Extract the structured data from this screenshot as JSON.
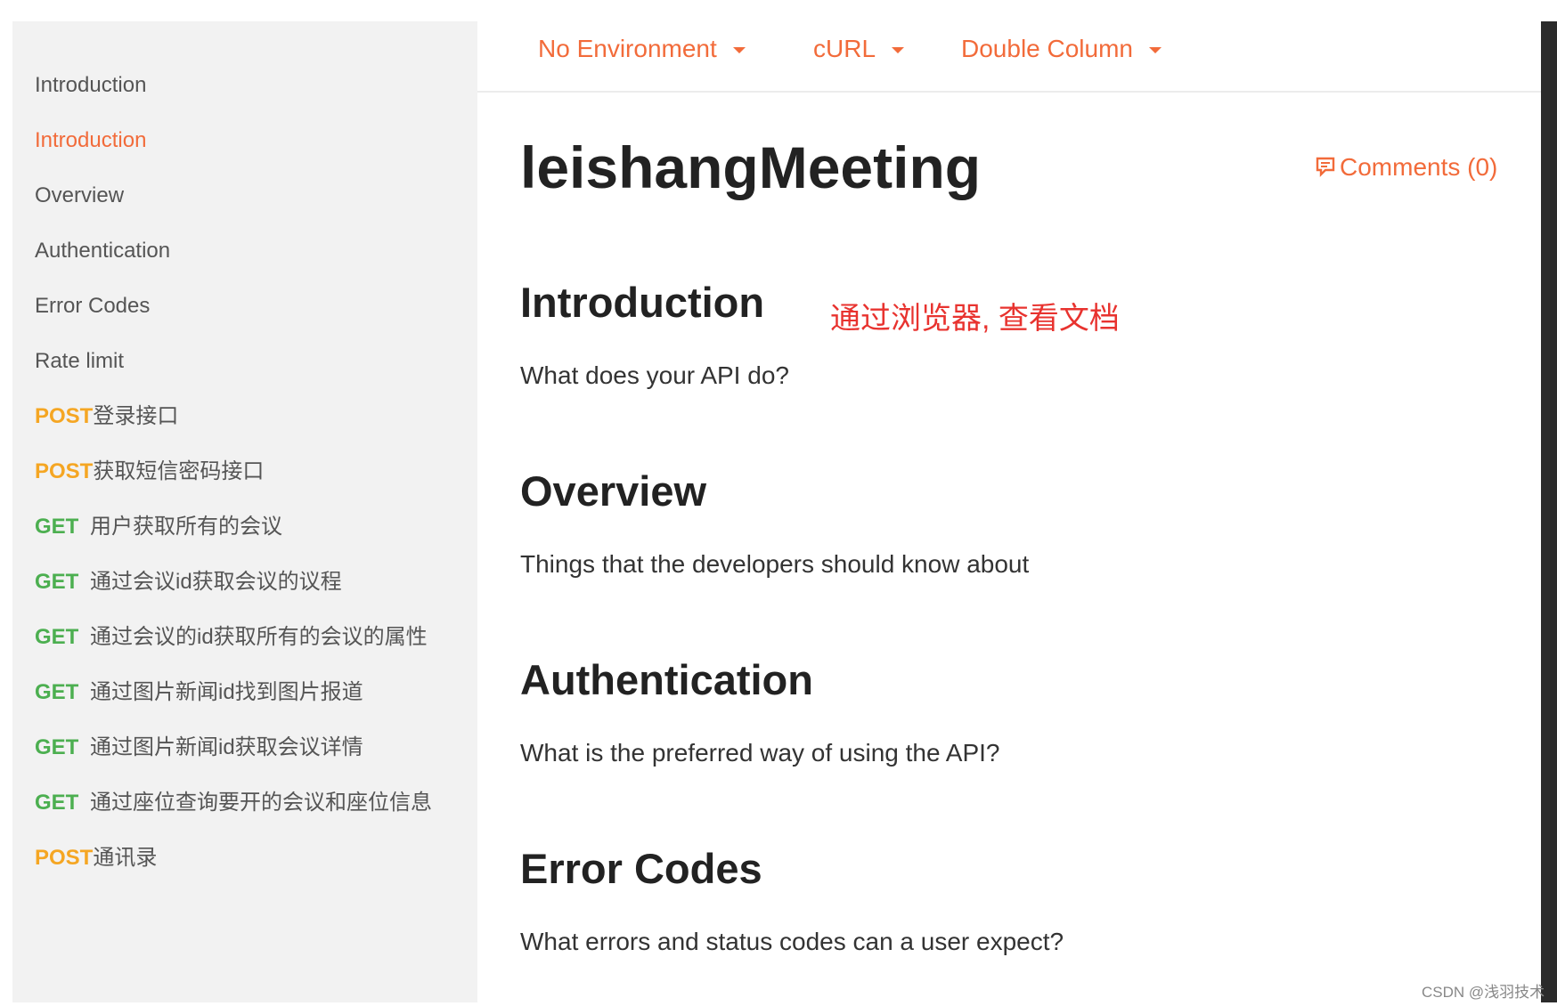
{
  "sidebar": {
    "items": [
      {
        "label": "Introduction"
      },
      {
        "label": "Introduction"
      },
      {
        "label": "Overview"
      },
      {
        "label": "Authentication"
      },
      {
        "label": "Error Codes"
      },
      {
        "label": "Rate limit"
      },
      {
        "method": "POST",
        "label": "登录接口"
      },
      {
        "method": "POST",
        "label": "获取短信密码接口"
      },
      {
        "method": "GET",
        "label": "用户获取所有的会议"
      },
      {
        "method": "GET",
        "label": "通过会议id获取会议的议程"
      },
      {
        "method": "GET",
        "label": "通过会议的id获取所有的会议的属性"
      },
      {
        "method": "GET",
        "label": "通过图片新闻id找到图片报道"
      },
      {
        "method": "GET",
        "label": "通过图片新闻id获取会议详情"
      },
      {
        "method": "GET",
        "label": "通过座位查询要开的会议和座位信息"
      },
      {
        "method": "POST",
        "label": "通讯录"
      }
    ]
  },
  "toolbar": {
    "environment": "No Environment",
    "language": "cURL",
    "layout": "Double Column"
  },
  "main": {
    "title": "leishangMeeting",
    "comments": "Comments (0)",
    "annotation": "通过浏览器, 查看文档",
    "sections": [
      {
        "heading": "Introduction",
        "text": "What does your API do?"
      },
      {
        "heading": "Overview",
        "text": "Things that the developers should know about"
      },
      {
        "heading": "Authentication",
        "text": "What is the preferred way of using the API?"
      },
      {
        "heading": "Error Codes",
        "text": "What errors and status codes can a user expect?"
      }
    ]
  },
  "watermark": "CSDN @浅羽技术",
  "colors": {
    "accent": "#f26b3a",
    "post": "#f5a623",
    "get": "#4caf50",
    "annotation": "#e8332f"
  }
}
